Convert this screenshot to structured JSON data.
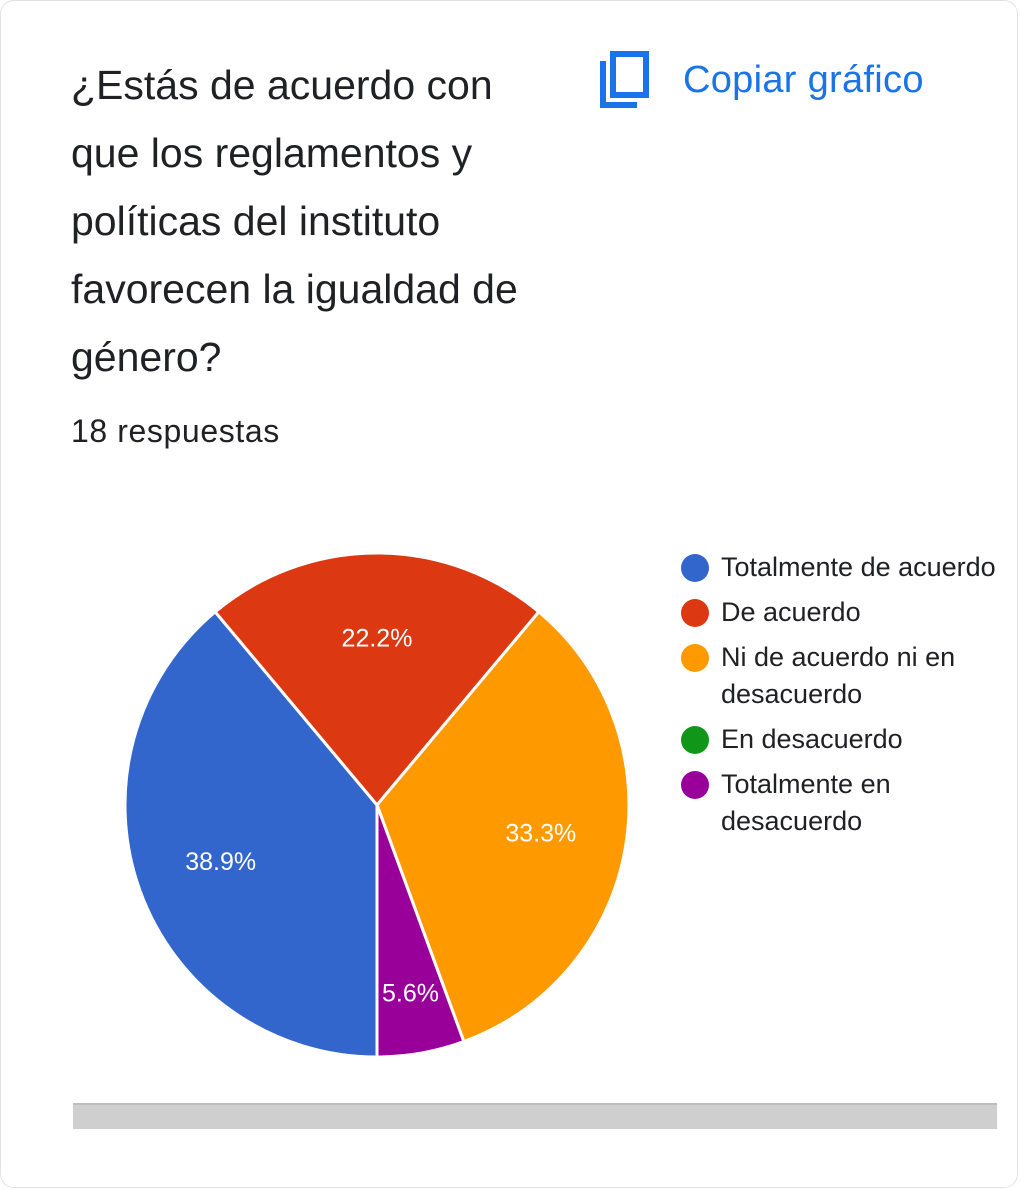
{
  "question": "¿Estás de acuerdo con que los reglamentos y políticas del instituto favorecen la igualdad de género?",
  "copy_button": {
    "label": "Copiar gráfico",
    "icon": "copy-icon",
    "color": "#1a73e8"
  },
  "responses_label": "18 respuestas",
  "chart_data": {
    "type": "pie",
    "legend_position": "right",
    "slices": [
      {
        "label": "Totalmente de acuerdo",
        "value": 38.9,
        "value_label": "38.9%",
        "color": "#3366cc"
      },
      {
        "label": "De acuerdo",
        "value": 22.2,
        "value_label": "22.2%",
        "color": "#dc3912"
      },
      {
        "label": "Ni de acuerdo ni en desacuerdo",
        "value": 33.3,
        "value_label": "33.3%",
        "color": "#ff9900"
      },
      {
        "label": "En desacuerdo",
        "value": 0,
        "value_label": "",
        "color": "#109618"
      },
      {
        "label": "Totalmente en desacuerdo",
        "value": 5.6,
        "value_label": "5.6%",
        "color": "#990099"
      }
    ]
  }
}
